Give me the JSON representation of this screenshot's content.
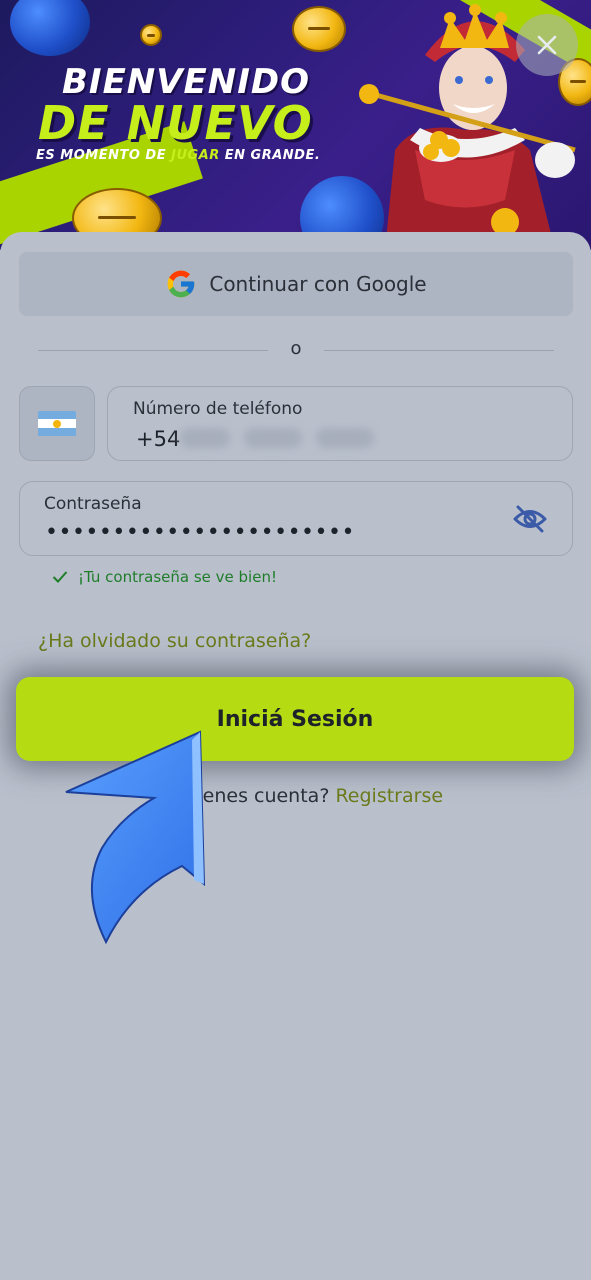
{
  "banner": {
    "title_line1": "BIENVENIDO",
    "title_line2": "DE NUEVO",
    "tagline_part1": "ES MOMENTO DE ",
    "tagline_accent": "JUGAR",
    "tagline_part2": " EN GRANDE."
  },
  "close_icon": "close-icon",
  "google_button": {
    "label": "Continuar con Google",
    "icon": "google-icon"
  },
  "divider": {
    "text": "o"
  },
  "country": {
    "flag": "argentina-flag-icon"
  },
  "phone": {
    "label": "Número de teléfono",
    "prefix": "+54"
  },
  "password": {
    "label": "Contraseña",
    "value": "•••••••••••••••••••••••",
    "toggle_icon": "eye-off-icon"
  },
  "validation": {
    "message": "¡Tu contraseña se ve bien!",
    "icon": "check-icon"
  },
  "forgot": {
    "label": "¿Ha olvidado su contraseña?"
  },
  "login_button": {
    "label": "Iniciá Sesión"
  },
  "register": {
    "prompt": "¿No tienes cuenta? ",
    "link": "Registrarse"
  },
  "colors": {
    "accent": "#b5dc12",
    "link": "#6b7a1b",
    "success": "#1f7d2a",
    "banner_bg": "#2d1d7a"
  }
}
